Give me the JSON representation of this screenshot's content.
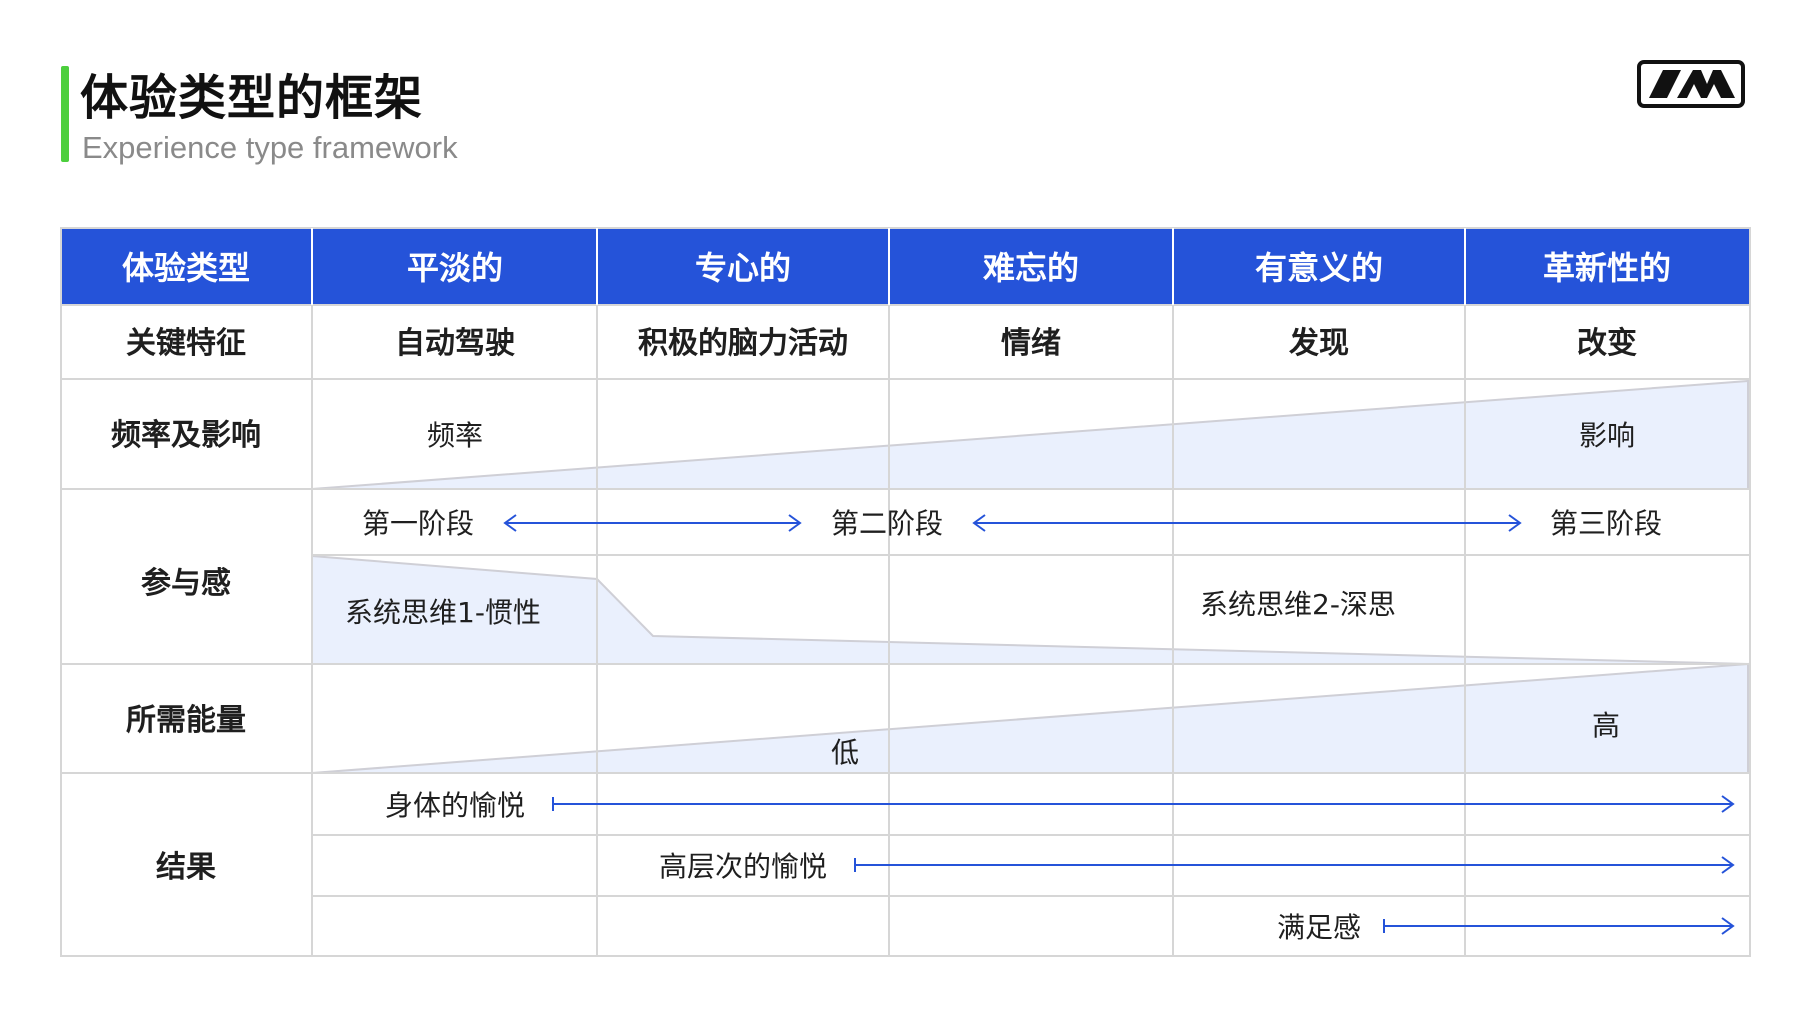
{
  "header": {
    "title": "体验类型的框架",
    "subtitle": "Experience type framework"
  },
  "colors": {
    "header_bg": "#2553d9",
    "grid": "#d6d6d6",
    "wedge_fill": "#eaf0fd",
    "wedge_stroke": "#cfcfd6",
    "arrow": "#2553d9",
    "accent": "#4ccf3d"
  },
  "table": {
    "header_row": [
      "体验类型",
      "平淡的",
      "专心的",
      "难忘的",
      "有意义的",
      "革新性的"
    ],
    "feature_row": [
      "关键特征",
      "自动驾驶",
      "积极的脑力活动",
      "情绪",
      "发现",
      "改变"
    ],
    "frequency": {
      "label": "频率及影响",
      "left": "频率",
      "right": "影响"
    },
    "engagement": {
      "label": "参与感",
      "stages": [
        "第一阶段",
        "第二阶段",
        "第三阶段"
      ],
      "system1": "系统思维1-惯性",
      "system2": "系统思维2-深思"
    },
    "energy": {
      "label": "所需能量",
      "low": "低",
      "high": "高"
    },
    "outcome": {
      "label": "结果",
      "items": [
        "身体的愉悦",
        "高层次的愉悦",
        "满足感"
      ]
    }
  }
}
